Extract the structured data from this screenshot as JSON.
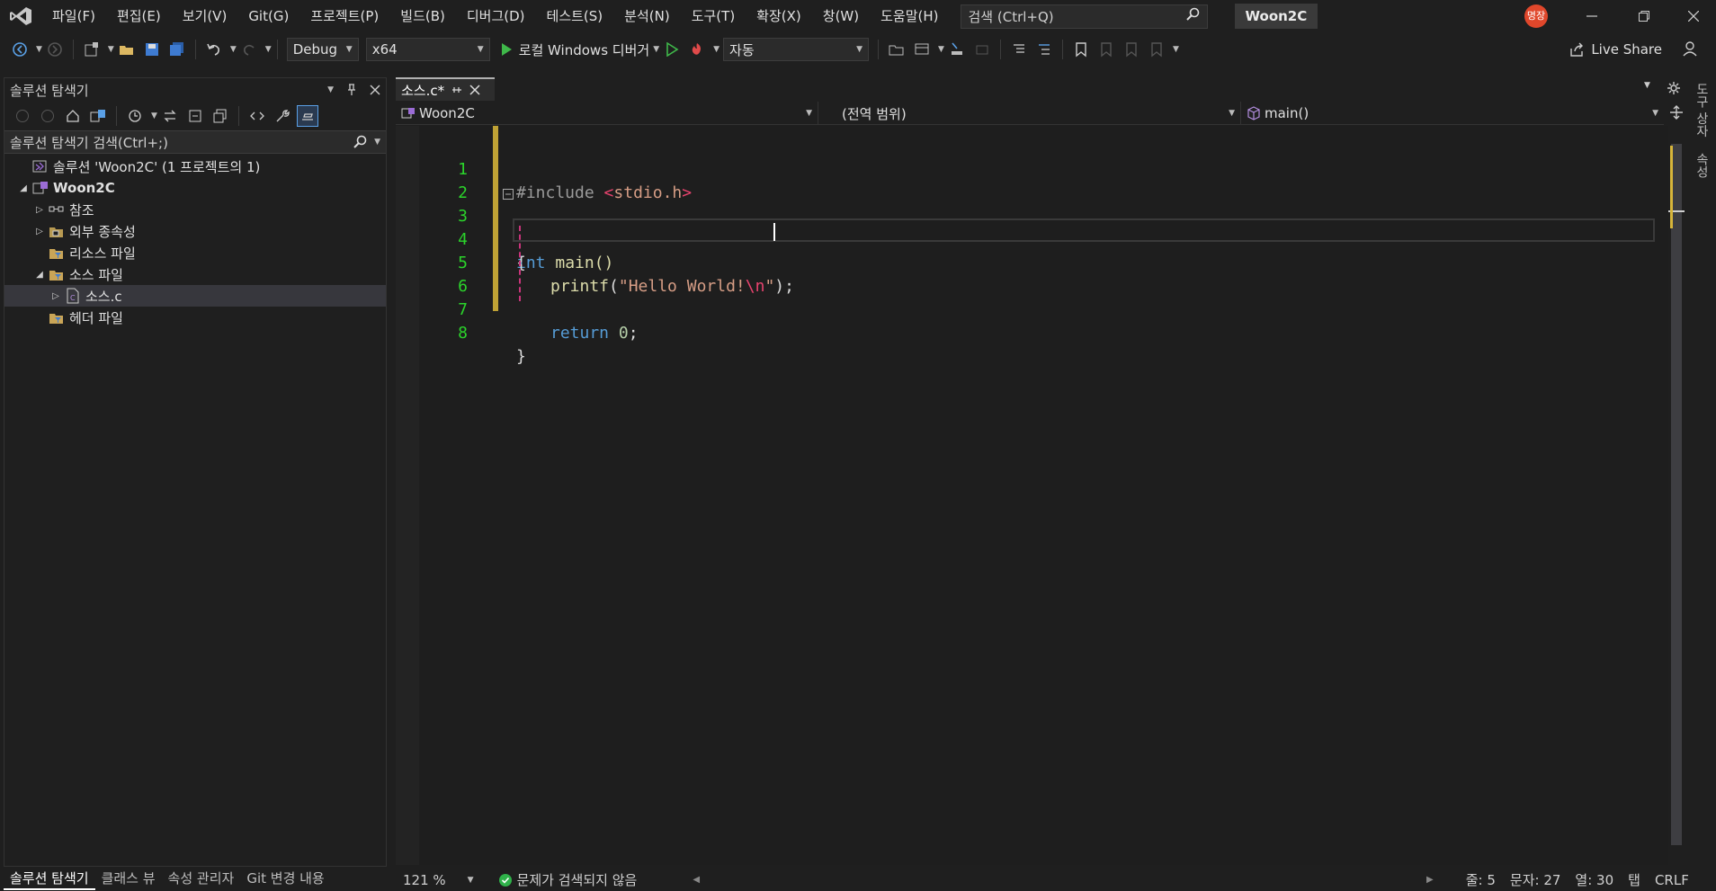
{
  "window": {
    "solution_name": "Woon2C",
    "avatar_initials": "명장"
  },
  "menu": [
    "파일(F)",
    "편집(E)",
    "보기(V)",
    "Git(G)",
    "프로젝트(P)",
    "빌드(B)",
    "디버그(D)",
    "테스트(S)",
    "분석(N)",
    "도구(T)",
    "확장(X)",
    "창(W)",
    "도움말(H)"
  ],
  "search": {
    "label": "검색 (Ctrl+Q)"
  },
  "toolbar": {
    "configuration": "Debug",
    "platform": "x64",
    "debugger_label": "로컬 Windows 디버거",
    "auto_label": "자동",
    "live_share": "Live Share"
  },
  "solution_explorer": {
    "title": "솔루션 탐색기",
    "search_placeholder": "솔루션 탐색기 검색(Ctrl+;)",
    "items": [
      {
        "label": "솔루션 'Woon2C' (1 프로젝트의 1)",
        "level": 0,
        "expander": "",
        "icon": "solution-icon"
      },
      {
        "label": "Woon2C",
        "level": 0,
        "expander": "expanded",
        "icon": "project-icon"
      },
      {
        "label": "참조",
        "level": 1,
        "expander": "collapsed",
        "icon": "references-icon"
      },
      {
        "label": "외부 종속성",
        "level": 1,
        "expander": "collapsed",
        "icon": "external-deps-icon"
      },
      {
        "label": "리소스 파일",
        "level": 1,
        "expander": "",
        "icon": "filter-folder-icon"
      },
      {
        "label": "소스 파일",
        "level": 1,
        "expander": "expanded",
        "icon": "filter-folder-icon"
      },
      {
        "label": "소스.c",
        "level": 2,
        "expander": "collapsed",
        "icon": "c-file-icon",
        "selected": true
      },
      {
        "label": "헤더 파일",
        "level": 1,
        "expander": "",
        "icon": "filter-folder-icon"
      }
    ],
    "bottom_tabs": [
      "솔루션 탐색기",
      "클래스 뷰",
      "속성 관리자",
      "Git 변경 내용"
    ]
  },
  "editor": {
    "tab_label": "소스.c*",
    "nav_project": "Woon2C",
    "nav_scope": "(전역 범위)",
    "nav_member": "main()",
    "line_numbers": [
      "1",
      "2",
      "3",
      "4",
      "5",
      "6",
      "7",
      "8"
    ],
    "code": {
      "l1_directive": "#include",
      "l1_lt": "<",
      "l1_header": "stdio.h",
      "l1_gt": ">",
      "l3_kw": "int",
      "l3_rest": " main()",
      "l4": "{",
      "l5_fn": "printf",
      "l5_open": "(",
      "l5_str": "\"Hello World!",
      "l5_esc": "\\n",
      "l5_quote": "\"",
      "l5_close": ");",
      "l7_kw": "return",
      "l7_num": "0",
      "l7_semi": ";",
      "l8": "}"
    }
  },
  "right_panel": [
    "도구 상자",
    "속성"
  ],
  "statusbar": {
    "zoom": "121 %",
    "issues": "문제가 검색되지 않음",
    "line": "줄: 5",
    "char": "문자: 27",
    "col": "열: 30",
    "tabs": "탭",
    "eol": "CRLF"
  },
  "colors": {
    "accent": "#569cd6",
    "line_number": "#2bd42b",
    "status_ok": "#2fb24a",
    "avatar": "#e0472b"
  }
}
